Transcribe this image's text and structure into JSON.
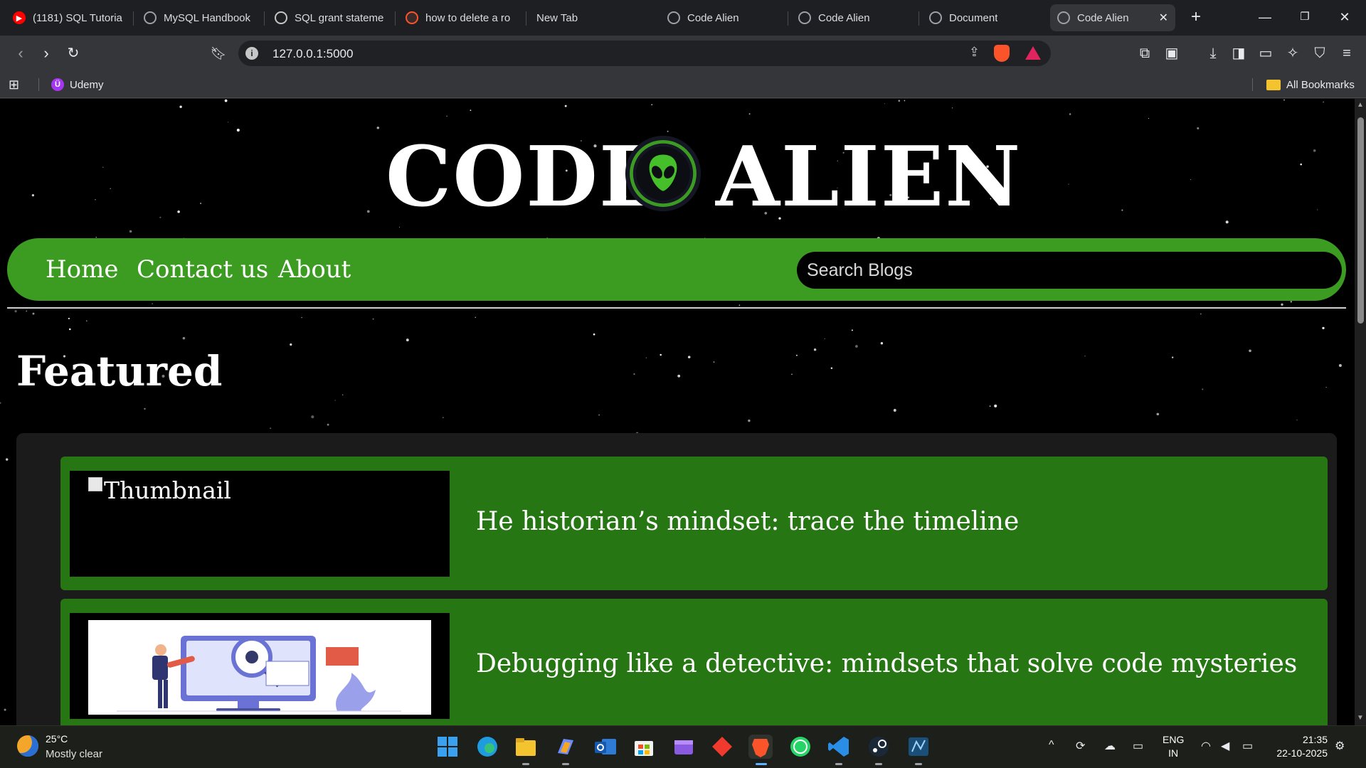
{
  "browser": {
    "tabs": [
      {
        "title": "(1181) SQL Tutoria",
        "icon": "youtube-icon",
        "color": "#ff0000"
      },
      {
        "title": "MySQL Handbook",
        "icon": "globe-icon",
        "color": "#9aa0a6"
      },
      {
        "title": "SQL grant stateme",
        "icon": "chatgpt-icon",
        "color": "#9aa0a6"
      },
      {
        "title": "how to delete a ro",
        "icon": "brave-search-icon",
        "color": "#fb542b"
      },
      {
        "title": "New Tab",
        "icon": "",
        "color": ""
      },
      {
        "title": "Code Alien",
        "icon": "globe-icon",
        "color": "#9aa0a6"
      },
      {
        "title": "Code Alien",
        "icon": "globe-icon",
        "color": "#9aa0a6"
      },
      {
        "title": "Document",
        "icon": "globe-icon",
        "color": "#9aa0a6"
      },
      {
        "title": "Code Alien",
        "icon": "globe-icon",
        "color": "#9aa0a6",
        "active": true
      }
    ],
    "url": "127.0.0.1:5000",
    "bookmarks": {
      "items": [
        {
          "label": "Udemy",
          "icon": "udemy-icon"
        }
      ],
      "all_bookmarks": "All Bookmarks"
    }
  },
  "site": {
    "logo_left": "CODE",
    "logo_right": "ALIEN",
    "nav": [
      {
        "label": "Home"
      },
      {
        "label": "Contact us"
      },
      {
        "label": "About"
      }
    ],
    "search_placeholder": "Search Blogs",
    "featured_heading": "Featured",
    "cards": [
      {
        "thumb_alt": "Thumbnail",
        "title": "He historian’s mindset: trace the timeline",
        "thumb_loaded": false
      },
      {
        "thumb_alt": "",
        "title": "Debugging like a detective: mindsets that solve code mysteries",
        "thumb_loaded": true
      }
    ],
    "colors": {
      "accent_green": "#3c9c22",
      "card_green": "#267614",
      "background": "#000000"
    }
  },
  "taskbar": {
    "weather": {
      "temp": "25°C",
      "condition": "Mostly clear"
    },
    "language": {
      "line1": "ENG",
      "line2": "IN"
    },
    "clock": {
      "time": "21:35",
      "date": "22-10-2025"
    },
    "apps": [
      "windows-start-icon",
      "edge-icon",
      "file-explorer-icon",
      "copilot-icon",
      "outlook-icon",
      "store-icon",
      "clipchamp-icon",
      "app-icon",
      "brave-icon",
      "whatsapp-icon",
      "vscode-icon",
      "steam-icon",
      "mysql-workbench-icon"
    ]
  }
}
